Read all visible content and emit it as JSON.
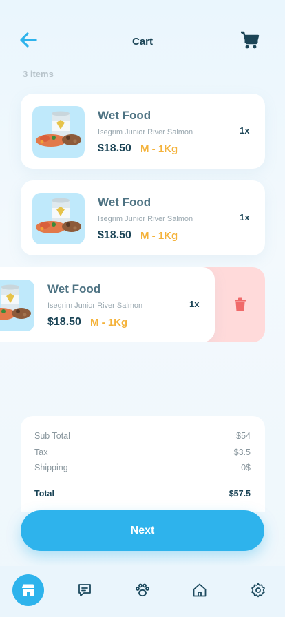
{
  "header": {
    "title": "Cart",
    "back_icon": "arrow-left-icon",
    "cart_icon": "shopping-cart-icon"
  },
  "cart": {
    "count_label": "3 items",
    "items": [
      {
        "name": "Wet Food",
        "description": "Isegrim Junior River Salmon",
        "price": "$18.50",
        "size": "M - 1Kg",
        "quantity": "1x"
      },
      {
        "name": "Wet Food",
        "description": "Isegrim Junior River Salmon",
        "price": "$18.50",
        "size": "M - 1Kg",
        "quantity": "1x"
      },
      {
        "name": "Wet Food",
        "description": "Isegrim Junior River Salmon",
        "price": "$18.50",
        "size": "M - 1Kg",
        "quantity": "1x"
      }
    ],
    "delete_icon": "trash-icon"
  },
  "summary": {
    "subtotal_label": "Sub Total",
    "subtotal_value": "$54",
    "tax_label": "Tax",
    "tax_value": "$3.5",
    "shipping_label": "Shipping",
    "shipping_value": "0$",
    "total_label": "Total",
    "total_value": "$57.5"
  },
  "actions": {
    "next_label": "Next"
  },
  "nav": {
    "items": [
      {
        "icon": "store-icon",
        "active": true
      },
      {
        "icon": "chat-icon",
        "active": false
      },
      {
        "icon": "paw-icon",
        "active": false
      },
      {
        "icon": "home-icon",
        "active": false
      },
      {
        "icon": "settings-icon",
        "active": false
      }
    ]
  },
  "colors": {
    "accent": "#2eb3ec",
    "price_accent": "#f4b23a",
    "delete_bg": "#ffdada",
    "delete_icon": "#f06a6a",
    "text_dark": "#1b4456"
  }
}
